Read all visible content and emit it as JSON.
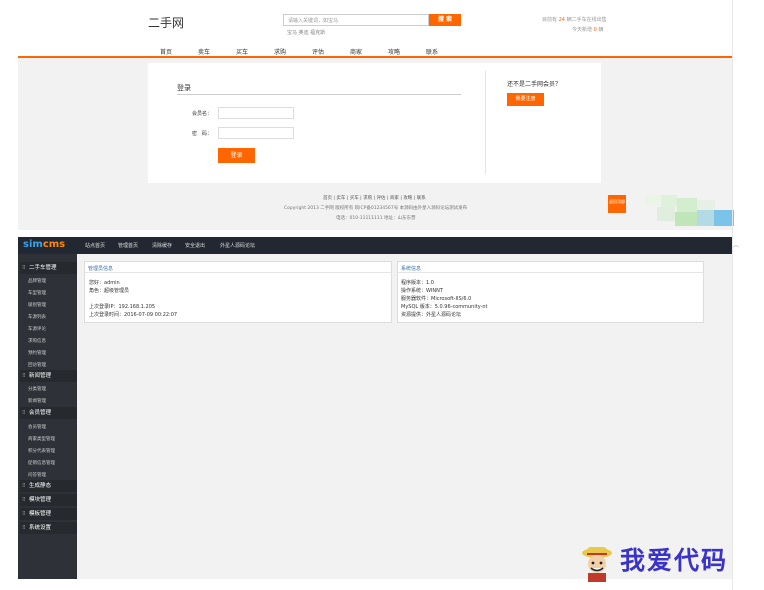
{
  "site": {
    "logo": "二手网",
    "search_placeholder": "请输入关键词，如宝马",
    "search_button": "搜 索",
    "hot_words": "宝马 奥迪 福克斯",
    "stats_line1_pre": "目前有",
    "stats_line1_num": "24",
    "stats_line1_post": "辆二手车在线出售",
    "stats_line2_pre": "今天新增",
    "stats_line2_num": "0",
    "stats_line2_post": "辆",
    "nav": [
      "首页",
      "卖车",
      "买车",
      "求购",
      "评估",
      "商家",
      "攻略",
      "联系"
    ],
    "login": {
      "title": "登录",
      "username_label": "会员名：",
      "password_label": "密　码：",
      "submit": "登录",
      "not_member": "还不是二手网会员？",
      "register": "我要注册"
    },
    "footer": {
      "links": "首页 | 卖车 | 买车 | 求购 | 评估 | 商家 | 攻略 | 联系",
      "copyright": "Copyright 2013 二手网 版权所有 皖ICP备01234567号 本源码由外星人源码论坛测试发布",
      "contact": "电话：010-11111111 地址：山东东营",
      "back_top": "返回顶部"
    }
  },
  "admin": {
    "logo_sim": "sim",
    "logo_cms": "cms",
    "top_menu": [
      "站点首页",
      "管理首页",
      "清除缓存",
      "安全退出",
      "外星人源码论坛"
    ],
    "sidebar": [
      {
        "title": "二手车管理",
        "items": [
          "品牌管理",
          "车型管理",
          "级别管理",
          "车源列表",
          "车源评论",
          "求购信息",
          "预约管理",
          "回访管理"
        ]
      },
      {
        "title": "新闻管理",
        "items": [
          "分类管理",
          "新闻管理"
        ]
      },
      {
        "title": "会员管理",
        "items": [
          "会员管理",
          "商家类型管理",
          "积分代表管理",
          "促销信息管理",
          "问答管理"
        ]
      },
      {
        "title": "生成静态",
        "items": []
      },
      {
        "title": "模块管理",
        "items": []
      },
      {
        "title": "模板管理",
        "items": []
      },
      {
        "title": "系统设置",
        "items": []
      }
    ],
    "admin_info": {
      "title": "管理员信息",
      "account": "您好：admin",
      "role": "角色：超级管理员",
      "last_ip": "上次登录IP：192.168.1.205",
      "last_time": "上次登录时间：2016-07-09 00:22:07"
    },
    "system_info": {
      "title": "系统信息",
      "version": "程序版本：1.0",
      "os": "操作系统：WINNT",
      "server": "服务器软件：Microsoft-IIS/6.0",
      "mysql": "MySQL 版本：5.0.96-community-nt",
      "support": "资源提供：外星人源码论坛"
    }
  },
  "watermark": "我爱代码",
  "colors": {
    "accent": "#ff6600",
    "admin_bar": "#222831",
    "sidebar": "#2e3238",
    "watermark": "#3a33c8"
  }
}
